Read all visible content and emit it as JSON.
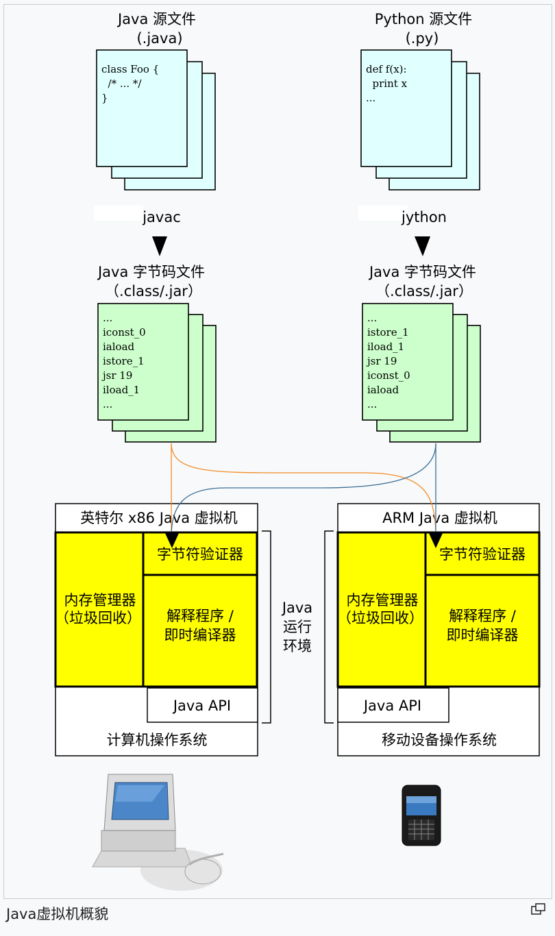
{
  "source_files": {
    "java": {
      "title": "Java 源文件",
      "ext": "(.java)",
      "code": [
        "class Foo {",
        "  /* ... */",
        "}"
      ]
    },
    "python": {
      "title": "Python 源文件",
      "ext": "(.py)",
      "code": [
        "def f(x):",
        "  print x",
        "..."
      ]
    }
  },
  "compilers": {
    "java": "javac",
    "python": "jython"
  },
  "bytecode_files": {
    "java": {
      "title": "Java 字节码文件",
      "ext": "（.class/.jar）",
      "code": [
        "...",
        "iconst_0",
        "iaload",
        "istore_1",
        "jsr 19",
        "iload_1",
        "..."
      ]
    },
    "python": {
      "title": "Java 字节码文件",
      "ext": "（.class/.jar）",
      "code": [
        "...",
        "istore_1",
        "iload_1",
        "jsr 19",
        "iconst_0",
        "iaload",
        "..."
      ]
    }
  },
  "vm_left": {
    "title": "英特尔 x86 Java 虚拟机",
    "memory_line1": "内存管理器",
    "memory_line2": "（垃圾回收）",
    "verifier": "字节符验证器",
    "interp_line1": "解释程序 /",
    "interp_line2": "即时编译器",
    "api": "Java API",
    "os": "计算机操作系统"
  },
  "vm_right": {
    "title": "ARM Java 虚拟机",
    "memory_line1": "内存管理器",
    "memory_line2": "（垃圾回收）",
    "verifier": "字节符验证器",
    "interp_line1": "解释程序 /",
    "interp_line2": "即时编译器",
    "api": "Java API",
    "os": "移动设备操作系统"
  },
  "jre_label": [
    "Java",
    "运行",
    "环境"
  ],
  "caption": "Java虚拟机概貌",
  "colors": {
    "source_file_fill": "#e0ffff",
    "bytecode_fill": "#ccffcc",
    "vm_component_fill": "#ffff00",
    "java_arrow": "#f28c28",
    "python_arrow": "#3a6e96"
  },
  "icons": {
    "desktop": "desktop-computer-icon",
    "phone": "mobile-phone-icon",
    "enlarge": "enlarge-icon"
  }
}
